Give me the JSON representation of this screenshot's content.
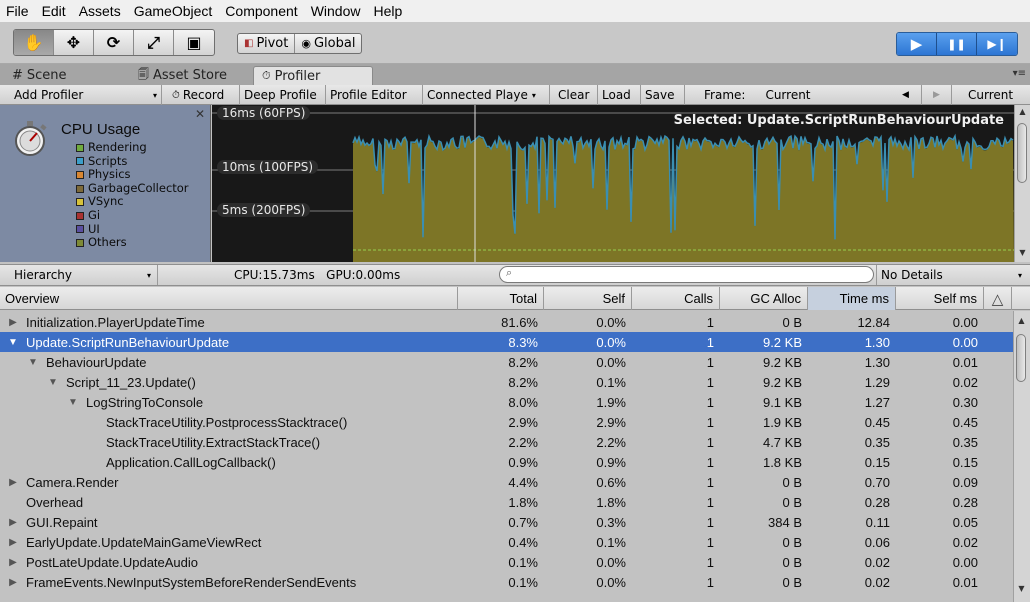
{
  "menu": [
    "File",
    "Edit",
    "Assets",
    "GameObject",
    "Component",
    "Window",
    "Help"
  ],
  "toolbar": {
    "tools": [
      "✋",
      "✥",
      "⟳",
      "⤢",
      "▣"
    ],
    "pivot_label": "Pivot",
    "global_label": "Global",
    "play": "▶",
    "pause": "❚❚",
    "step": "▶❙"
  },
  "tabs": [
    {
      "label": "Scene",
      "icon": "#"
    },
    {
      "label": "Asset Store",
      "icon": "🗐"
    },
    {
      "label": "Profiler",
      "icon": "⏱"
    }
  ],
  "profiler_toolbar": {
    "add_profiler": "Add Profiler",
    "record": "Record",
    "deep_profile": "Deep Profile",
    "profile_editor": "Profile Editor",
    "connected_player": "Connected Playe",
    "clear": "Clear",
    "load": "Load",
    "save": "Save",
    "frame_label": "Frame:",
    "frame_value": "Current",
    "current_button": "Current"
  },
  "cpu_module": {
    "title": "CPU Usage",
    "legend": [
      {
        "name": "Rendering",
        "color": "#6fab3e"
      },
      {
        "name": "Scripts",
        "color": "#3c9ec9"
      },
      {
        "name": "Physics",
        "color": "#d88632"
      },
      {
        "name": "GarbageCollector",
        "color": "#7d6a3a"
      },
      {
        "name": "VSync",
        "color": "#d7c23a"
      },
      {
        "name": "Gi",
        "color": "#a83232"
      },
      {
        "name": "UI",
        "color": "#5a4fa0"
      },
      {
        "name": "Others",
        "color": "#7d8a36"
      }
    ],
    "graph_labels": [
      "16ms (60FPS)",
      "10ms (100FPS)",
      "5ms (200FPS)"
    ],
    "selected_text": "Selected: Update.ScriptRunBehaviourUpdate"
  },
  "hierarchy_toolbar": {
    "view": "Hierarchy",
    "stats": "CPU:15.73ms   GPU:0.00ms",
    "details": "No Details"
  },
  "columns": [
    "Overview",
    "Total",
    "Self",
    "Calls",
    "GC Alloc",
    "Time ms",
    "Self ms"
  ],
  "rows": [
    {
      "name": "Initialization.PlayerUpdateTime",
      "indent": 0,
      "expander": "▶",
      "total": "81.6%",
      "self": "0.0%",
      "calls": "1",
      "gc": "0 B",
      "time": "12.84",
      "selfms": "0.00",
      "selected": false
    },
    {
      "name": "Update.ScriptRunBehaviourUpdate",
      "indent": 0,
      "expander": "▼",
      "total": "8.3%",
      "self": "0.0%",
      "calls": "1",
      "gc": "9.2 KB",
      "time": "1.30",
      "selfms": "0.00",
      "selected": true
    },
    {
      "name": "BehaviourUpdate",
      "indent": 1,
      "expander": "▼",
      "total": "8.2%",
      "self": "0.0%",
      "calls": "1",
      "gc": "9.2 KB",
      "time": "1.30",
      "selfms": "0.01",
      "selected": false
    },
    {
      "name": "Script_11_23.Update()",
      "indent": 2,
      "expander": "▼",
      "total": "8.2%",
      "self": "0.1%",
      "calls": "1",
      "gc": "9.2 KB",
      "time": "1.29",
      "selfms": "0.02",
      "selected": false
    },
    {
      "name": "LogStringToConsole",
      "indent": 3,
      "expander": "▼",
      "total": "8.0%",
      "self": "1.9%",
      "calls": "1",
      "gc": "9.1 KB",
      "time": "1.27",
      "selfms": "0.30",
      "selected": false
    },
    {
      "name": "StackTraceUtility.PostprocessStacktrace()",
      "indent": 4,
      "expander": "",
      "total": "2.9%",
      "self": "2.9%",
      "calls": "1",
      "gc": "1.9 KB",
      "time": "0.45",
      "selfms": "0.45",
      "selected": false
    },
    {
      "name": "StackTraceUtility.ExtractStackTrace()",
      "indent": 4,
      "expander": "",
      "total": "2.2%",
      "self": "2.2%",
      "calls": "1",
      "gc": "4.7 KB",
      "time": "0.35",
      "selfms": "0.35",
      "selected": false
    },
    {
      "name": "Application.CallLogCallback()",
      "indent": 4,
      "expander": "",
      "total": "0.9%",
      "self": "0.9%",
      "calls": "1",
      "gc": "1.8 KB",
      "time": "0.15",
      "selfms": "0.15",
      "selected": false
    },
    {
      "name": "Camera.Render",
      "indent": 0,
      "expander": "▶",
      "total": "4.4%",
      "self": "0.6%",
      "calls": "1",
      "gc": "0 B",
      "time": "0.70",
      "selfms": "0.09",
      "selected": false
    },
    {
      "name": "Overhead",
      "indent": 0,
      "expander": "",
      "total": "1.8%",
      "self": "1.8%",
      "calls": "1",
      "gc": "0 B",
      "time": "0.28",
      "selfms": "0.28",
      "selected": false
    },
    {
      "name": "GUI.Repaint",
      "indent": 0,
      "expander": "▶",
      "total": "0.7%",
      "self": "0.3%",
      "calls": "1",
      "gc": "384 B",
      "time": "0.11",
      "selfms": "0.05",
      "selected": false
    },
    {
      "name": "EarlyUpdate.UpdateMainGameViewRect",
      "indent": 0,
      "expander": "▶",
      "total": "0.4%",
      "self": "0.1%",
      "calls": "1",
      "gc": "0 B",
      "time": "0.06",
      "selfms": "0.02",
      "selected": false
    },
    {
      "name": "PostLateUpdate.UpdateAudio",
      "indent": 0,
      "expander": "▶",
      "total": "0.1%",
      "self": "0.0%",
      "calls": "1",
      "gc": "0 B",
      "time": "0.02",
      "selfms": "0.00",
      "selected": false
    },
    {
      "name": "FrameEvents.NewInputSystemBeforeRenderSendEvents",
      "indent": 0,
      "expander": "▶",
      "total": "0.1%",
      "self": "0.0%",
      "calls": "1",
      "gc": "0 B",
      "time": "0.02",
      "selfms": "0.01",
      "selected": false
    }
  ]
}
